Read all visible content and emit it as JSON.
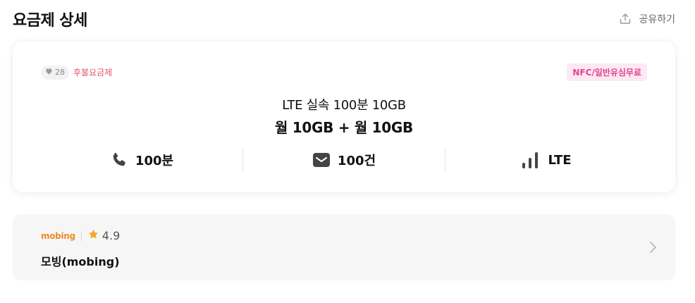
{
  "header": {
    "title": "요금제 상세",
    "share_label": "공유하기"
  },
  "plan": {
    "likes": "28",
    "type": "후불요금제",
    "feature_tag": "NFC/일반유심무료",
    "name": "LTE 실속 100분 10GB",
    "headline": "월 10GB + 월 10GB",
    "stats": {
      "voice": "100분",
      "sms": "100건",
      "network": "LTE"
    }
  },
  "carrier": {
    "logo_text": "mobing",
    "rating": "4.9",
    "name": "모빙(mobing)"
  },
  "colors": {
    "accent_pink": "#e0468f",
    "plan_type_red": "#e0556b",
    "star": "#f5a623",
    "logo_orange": "#f08a24"
  }
}
